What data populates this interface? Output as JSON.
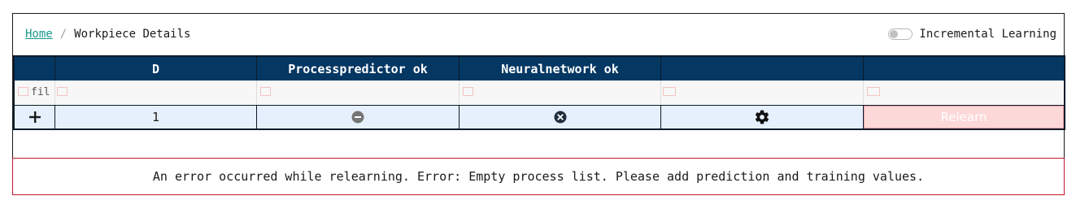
{
  "breadcrumb": {
    "home": "Home",
    "separator": "/",
    "current": "Workpiece Details"
  },
  "toggle": {
    "label": "Incremental Learning",
    "on": false
  },
  "table": {
    "headers": [
      "",
      "D",
      "Processpredictor ok",
      "Neuralnetwork ok",
      "",
      ""
    ],
    "filter_placeholder": "fil",
    "row": {
      "expand_icon": "plus-icon",
      "d_value": "1",
      "processpredictor_icon": "minus-circle-icon",
      "neuralnetwork_icon": "x-circle-icon",
      "settings_icon": "gear-icon",
      "relearn_label": "Relearn"
    }
  },
  "error_message": "An error occurred while relearning. Error: Empty process list. Please add prediction and training values."
}
